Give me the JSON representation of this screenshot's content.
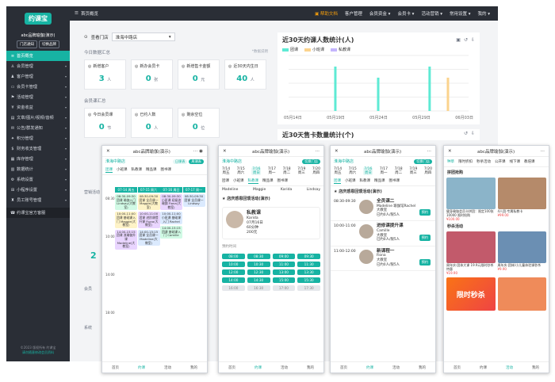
{
  "sidebar": {
    "logo": "约课宝",
    "brand": "abc品牌瑜伽(演示)",
    "btn_store": "门店通知",
    "btn_switch": "切换品牌",
    "items": [
      {
        "label": "首页概览",
        "icon": "≡",
        "active": true
      },
      {
        "label": "会员管理",
        "icon": "♙"
      },
      {
        "label": "客户管理",
        "icon": "♟"
      },
      {
        "label": "会员卡管理",
        "icon": "▭"
      },
      {
        "label": "活动管理",
        "icon": "⚑"
      },
      {
        "label": "资金收益",
        "icon": "¥"
      },
      {
        "label": "文章/图片/视频/音频",
        "icon": "▤"
      },
      {
        "label": "公告/群发通知",
        "icon": "✉"
      },
      {
        "label": "积分管理",
        "icon": "✦"
      },
      {
        "label": "财务收支管理",
        "icon": "$"
      },
      {
        "label": "库存管理",
        "icon": "▦"
      },
      {
        "label": "数据统计",
        "icon": "▥"
      },
      {
        "label": "系统设置",
        "icon": "⚙"
      },
      {
        "label": "小程序设置",
        "icon": "⊞"
      },
      {
        "label": "员工账号管理",
        "icon": "♜"
      }
    ],
    "bottom_item": "约课宝官方客服",
    "footer1": "©2023 版权所有 约课宝",
    "footer2": "请勿随意修改会员资料"
  },
  "topbar": {
    "crumb": "首页概览",
    "help": "帮助文档",
    "menu": [
      "客户管理",
      "会员资金",
      "会员卡",
      "活动营销",
      "常用设置",
      "我的"
    ]
  },
  "overview": {
    "store_label": "查看门店",
    "store_value": "淮海中路店",
    "today_title": "今日数据汇总",
    "note": "*数据说明",
    "cards_today": [
      {
        "label": "新增客户",
        "value": "3",
        "unit": "人"
      },
      {
        "label": "新办会员卡",
        "value": "0",
        "unit": "张"
      },
      {
        "label": "新增售卡金额",
        "value": "0",
        "unit": "元"
      },
      {
        "label": "近30天内生日",
        "value": "40",
        "unit": "人"
      }
    ],
    "course_title": "会员课汇总",
    "cards_course": [
      {
        "label": "今日会员课",
        "value": "0",
        "unit": "节"
      },
      {
        "label": "已约人数",
        "value": "0",
        "unit": "人"
      },
      {
        "label": "剩余空位",
        "value": "0",
        "unit": "位"
      }
    ],
    "stub_sections": [
      "营销活动",
      "2",
      "会员",
      "系统"
    ]
  },
  "chart_panel": {
    "title": "近30天约课人数统计(人)",
    "chart2_title": "近30天售卡数量统计(个)",
    "tools": [
      "▣",
      "↺",
      "⇩"
    ]
  },
  "chart_data": {
    "type": "bar",
    "title": "近30天约课人数统计(人)",
    "x_ticks": [
      "05月14日",
      "05月19日",
      "05月24日",
      "05月29日",
      "06月03日"
    ],
    "series": [
      {
        "name": "团课",
        "color": "#5eead4",
        "values": [
          0,
          0,
          0,
          0,
          0,
          4,
          0,
          0,
          0,
          0,
          3,
          0,
          0,
          0,
          0,
          0,
          4,
          0,
          0,
          0,
          0
        ]
      },
      {
        "name": "小班课",
        "color": "#fbd38d",
        "values": [
          0,
          0,
          0,
          0,
          0,
          0,
          0,
          0,
          0,
          0,
          0,
          0,
          0,
          0,
          0,
          0,
          0,
          0,
          3,
          0,
          0
        ]
      },
      {
        "name": "私教课",
        "color": "#c4b5fd",
        "values": [
          0,
          0,
          0,
          0,
          0,
          0,
          0,
          0,
          0,
          0,
          0,
          0,
          0,
          0,
          0,
          0,
          0,
          0,
          0,
          0,
          0
        ]
      }
    ],
    "grid": true,
    "legend": "top-left"
  },
  "phones": {
    "brand_title": "abc品牌瑜伽(演示)",
    "store": "淮海中路店",
    "switch": "切换门店",
    "view_pills": [
      "日课表",
      "周课表"
    ],
    "tabs": [
      "团课",
      "小班课",
      "私教课",
      "精品课",
      "图书课"
    ],
    "dates": [
      {
        "d": "7/14",
        "w": "周五"
      },
      {
        "d": "7/15",
        "w": "周六"
      },
      {
        "d": "7/16",
        "w": "周日"
      },
      {
        "d": "7/17",
        "w": "周一"
      },
      {
        "d": "7/18",
        "w": "周二"
      },
      {
        "d": "7/19",
        "w": "周三"
      },
      {
        "d": "7/20",
        "w": "周四"
      }
    ],
    "footer": [
      "首页",
      "约课",
      "活动",
      "我的"
    ],
    "p1": {
      "heads": [
        "07-14 周五",
        "07-15 周六",
        "07-16 周日",
        "07-17 周一"
      ],
      "times": [
        "08:30",
        "10:00",
        "14:00",
        "18:00"
      ],
      "cells": [
        [
          "08:30-09:30 团课 瑜伽入门 Lindsay(大教室)",
          "08:30-09:30 团课 全员课一 Maggie(大教室)",
          "08:30-09:30 小班课 初级流瑜伽 Fiona(大教室)",
          "08:30-09:30 团课 全员课一 Lindsay"
        ],
        [
          "10:00-11:00 团课 基础课入门 Maggie(大教室)",
          "10:00-11:00 团课 进阶课提升课 Fiona(大教室)",
          "10:00-11:00 小班课 基础课入门 Rachel",
          ""
        ],
        [
          "14:00-15:15 团课 流瑜伽升课 Madeline(大教室)",
          "14:00-15:15 团课 全员课一 Madeline(大教室)",
          "14:00-15:15 团课 基础课入门 Camille",
          ""
        ]
      ]
    },
    "p2": {
      "course_name": "私教课",
      "teacher": "Karida",
      "date": "07月16日",
      "duration": "60分钟",
      "price": "200元",
      "section": "店庆感恩回馈活动(演示)",
      "slots_label": "预约时间",
      "slots": [
        "08:00",
        "08:30",
        "09:00",
        "09:30",
        "10:00",
        "10:30",
        "11:00",
        "11:30",
        "12:00",
        "12:30",
        "13:00",
        "13:30",
        "14:00",
        "14:30",
        "15:00",
        "15:30",
        "16:00",
        "16:30",
        "17:00",
        "17:30"
      ],
      "teachers": [
        "Madeline",
        "Maggie",
        "Karida",
        "Lindsay"
      ]
    },
    "p3": {
      "section": "店庆感恩回馈活动(演示)",
      "lessons": [
        {
          "time": "08:30-09:30",
          "name": "全员课二",
          "teacher": "Madeline 瑜伽馆Rachel",
          "room": "大教室",
          "booked": "已约0人/限5人",
          "btn": "预约"
        },
        {
          "time": "10:00-11:00",
          "name": "进修课提升课",
          "teacher": "Camille",
          "room": "大教室",
          "booked": "已约0人/限5人",
          "btn": "预约"
        },
        {
          "time": "11:00-12:00",
          "name": "新课程一",
          "teacher": "Fiona",
          "room": "大教室",
          "booked": "已约0人/限5人",
          "btn": "预约"
        }
      ]
    },
    "p4": {
      "tabs": [
        "种草",
        "限时折扣",
        "秒杀活动",
        "公开课",
        "线下课",
        "教培课"
      ],
      "section1": "拼团抢购",
      "items1": [
        {
          "cap": "健身瑜伽会员卡拼团：限定100张10000 限时抢购",
          "price": "¥100.00"
        },
        {
          "cap": "4人团·专属私教卡",
          "price": "¥99.00"
        }
      ],
      "section2": "秒杀活动",
      "items2": [
        {
          "cap": "周年庆·团体大课 19.9元限时秒杀特惠",
          "price": "¥19.90"
        },
        {
          "cap": "周年庆·团体/小儿童体验课秒杀",
          "price": "¥9.90"
        }
      ],
      "promo": "限时秒杀"
    }
  }
}
